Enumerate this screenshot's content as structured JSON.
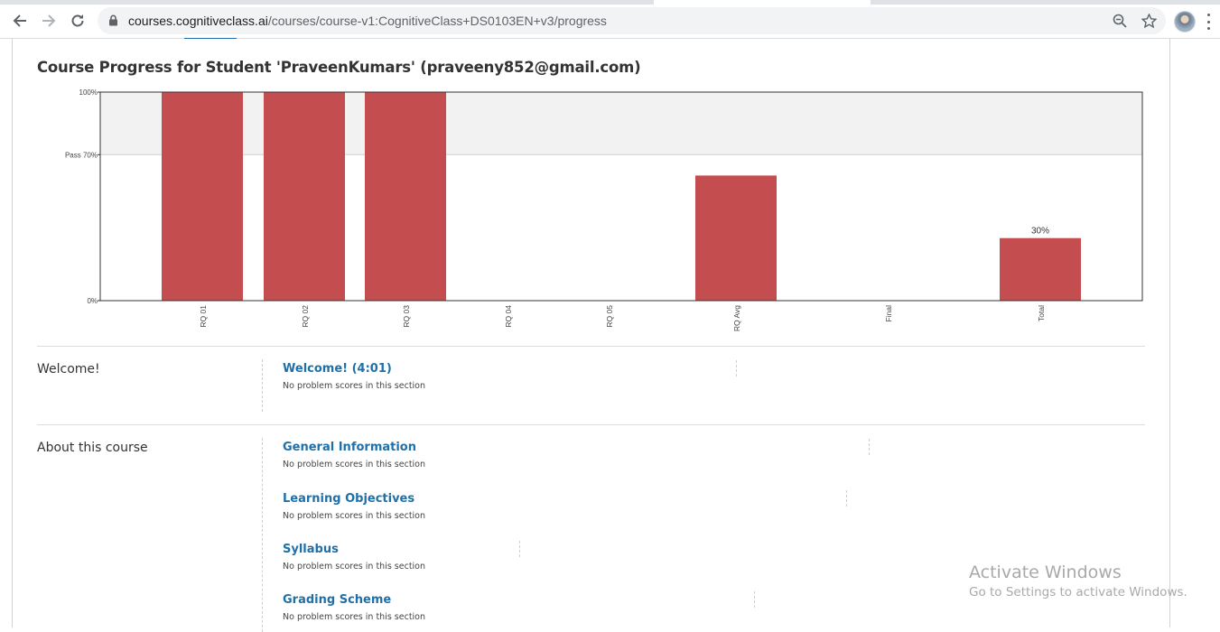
{
  "browser": {
    "url_host": "courses.cognitiveclass.ai",
    "url_path": "/courses/course-v1:CognitiveClass+DS0103EN+v3/progress"
  },
  "page": {
    "title": "Course Progress for Student 'PraveenKumars' (praveeny852@gmail.com)"
  },
  "chart_data": {
    "type": "bar",
    "categories": [
      "RQ 01",
      "RQ 02",
      "RQ 03",
      "RQ 04",
      "RQ 05",
      "RQ Avg",
      "Final",
      "Total"
    ],
    "values": [
      100,
      100,
      100,
      0,
      0,
      60,
      0,
      30
    ],
    "y_tick_labels": [
      "100%",
      "Pass 70%",
      "0%"
    ],
    "data_labels": [
      {
        "category": "Total",
        "label": "30%"
      }
    ],
    "ylim": [
      0,
      100
    ],
    "pass_threshold": 70,
    "bar_color": "#c44d4f",
    "pass_band_color": "#f2f2f2"
  },
  "sections": [
    {
      "chapter": "Welcome!",
      "subsections": [
        {
          "title": "Welcome! (4:01)",
          "note": "No problem scores in this section"
        }
      ]
    },
    {
      "chapter": "About this course",
      "subsections": [
        {
          "title": "General Information",
          "note": "No problem scores in this section"
        },
        {
          "title": "Learning Objectives",
          "note": "No problem scores in this section"
        },
        {
          "title": "Syllabus",
          "note": "No problem scores in this section"
        },
        {
          "title": "Grading Scheme",
          "note": "No problem scores in this section"
        }
      ]
    }
  ],
  "watermark": {
    "title": "Activate Windows",
    "subtitle": "Go to Settings to activate Windows."
  },
  "colors": {
    "link": "#1f6fa8",
    "accent_underline": "#1c6fb7"
  }
}
